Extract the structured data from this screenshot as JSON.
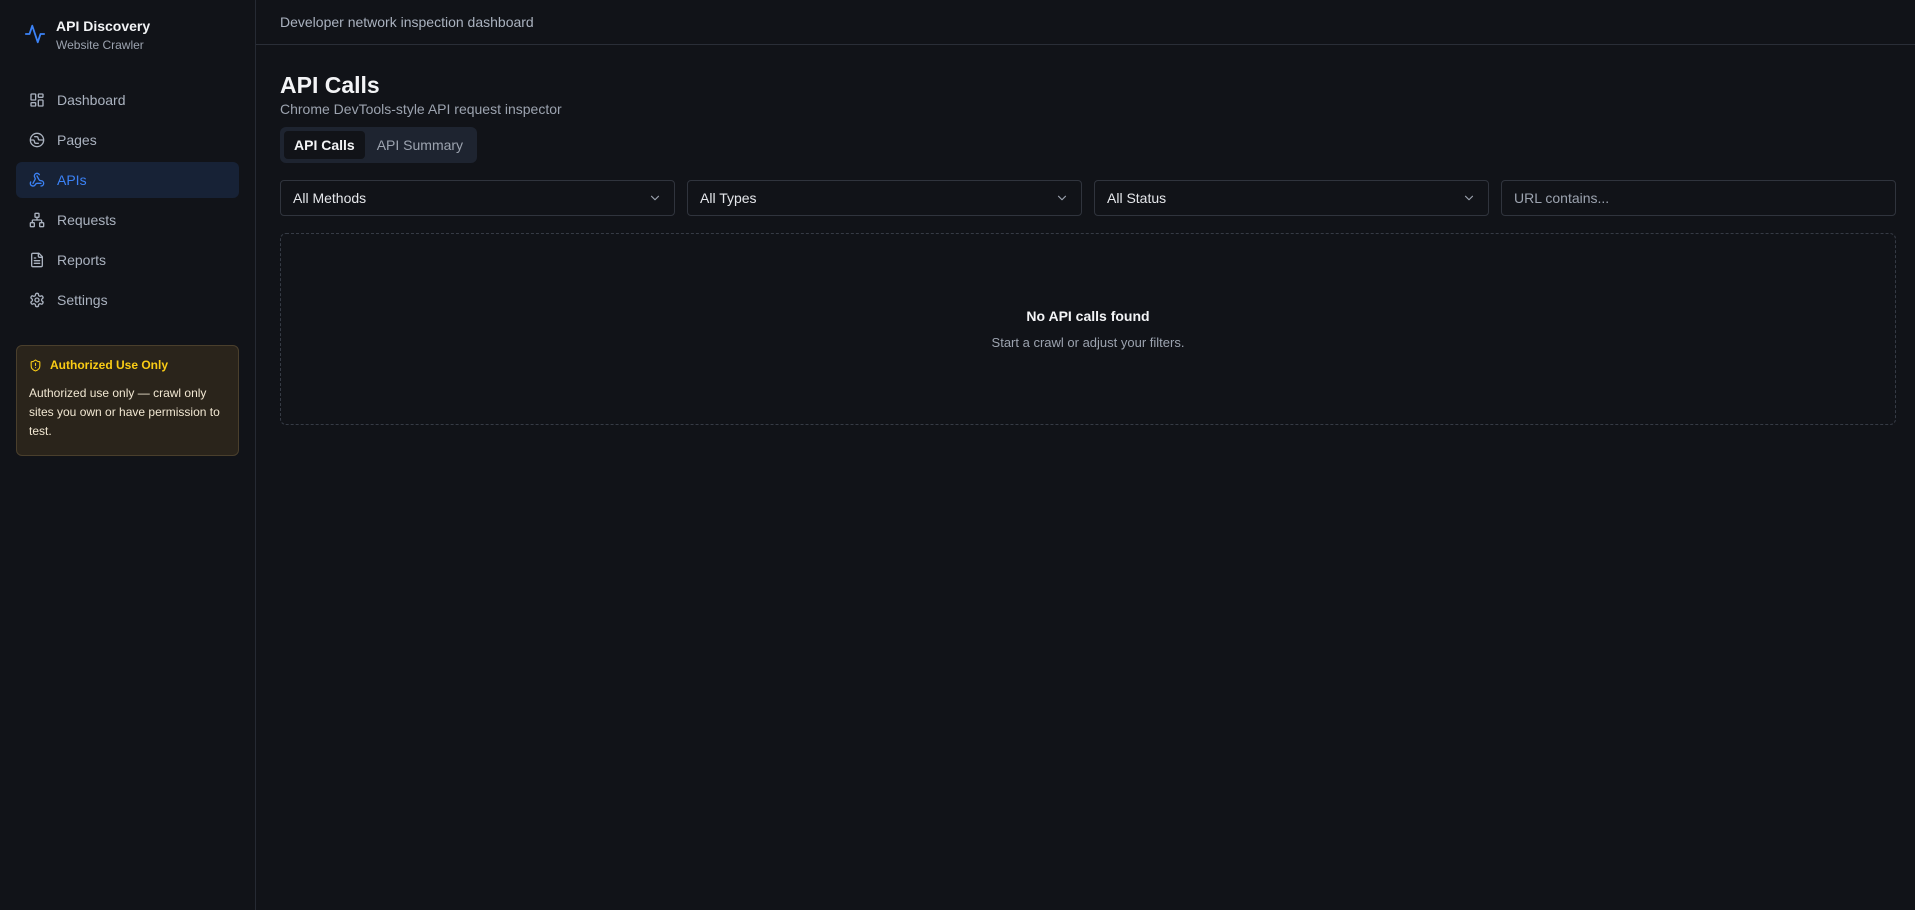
{
  "brand": {
    "title": "API Discovery",
    "subtitle": "Website Crawler",
    "icon": "activity-icon",
    "accent": "#3b82f6"
  },
  "sidebar": {
    "items": [
      {
        "label": "Dashboard",
        "icon": "dashboard-icon",
        "active": false
      },
      {
        "label": "Pages",
        "icon": "globe-icon",
        "active": false
      },
      {
        "label": "APIs",
        "icon": "webhook-icon",
        "active": true
      },
      {
        "label": "Requests",
        "icon": "network-icon",
        "active": false
      },
      {
        "label": "Reports",
        "icon": "file-text-icon",
        "active": false
      },
      {
        "label": "Settings",
        "icon": "gear-icon",
        "active": false
      }
    ],
    "notice": {
      "title": "Authorized Use Only",
      "body": "Authorized use only — crawl only sites you own or have permission to test.",
      "icon": "shield-icon",
      "color": "#facc15"
    }
  },
  "header": {
    "subtitle": "Developer network inspection dashboard"
  },
  "main": {
    "title": "API Calls",
    "subtitle": "Chrome DevTools-style API request inspector",
    "tabs": [
      {
        "label": "API Calls",
        "active": true
      },
      {
        "label": "API Summary",
        "active": false
      }
    ],
    "filters": {
      "method": "All Methods",
      "type": "All Types",
      "status": "All Status",
      "url_placeholder": "URL contains..."
    },
    "empty": {
      "title": "No API calls found",
      "message": "Start a crawl or adjust your filters."
    }
  }
}
